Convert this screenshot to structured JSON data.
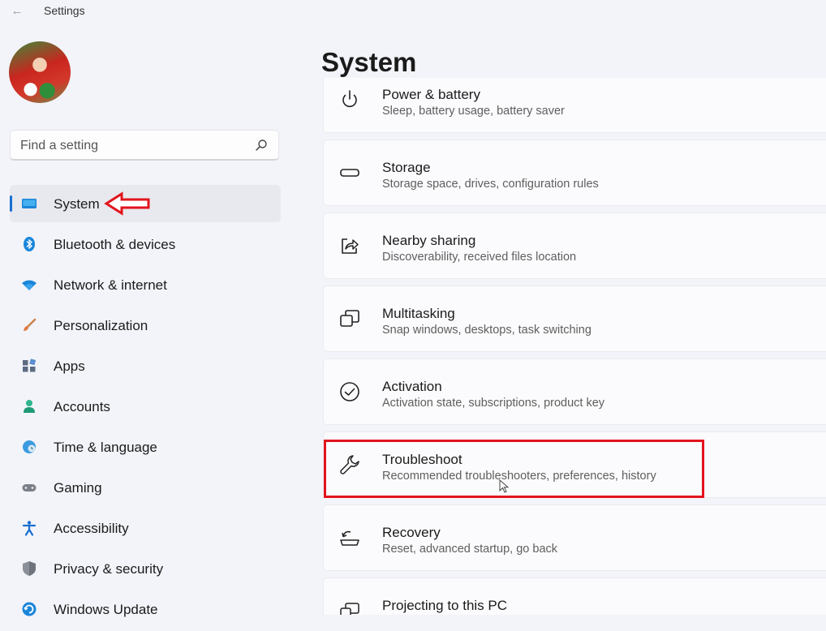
{
  "window": {
    "title": "Settings",
    "back_glyph": "←"
  },
  "user": {
    "avatar": "user-avatar"
  },
  "search": {
    "placeholder": "Find a setting",
    "value": "",
    "icon": "search-icon"
  },
  "sidebar": {
    "items": [
      {
        "label": "System",
        "icon": "monitor-icon",
        "active": true
      },
      {
        "label": "Bluetooth & devices",
        "icon": "bluetooth-icon"
      },
      {
        "label": "Network & internet",
        "icon": "wifi-icon"
      },
      {
        "label": "Personalization",
        "icon": "brush-icon"
      },
      {
        "label": "Apps",
        "icon": "apps-icon"
      },
      {
        "label": "Accounts",
        "icon": "person-icon"
      },
      {
        "label": "Time & language",
        "icon": "globe-clock-icon"
      },
      {
        "label": "Gaming",
        "icon": "gamepad-icon"
      },
      {
        "label": "Accessibility",
        "icon": "accessibility-icon"
      },
      {
        "label": "Privacy & security",
        "icon": "shield-icon"
      },
      {
        "label": "Windows Update",
        "icon": "update-icon"
      }
    ]
  },
  "main": {
    "title": "System",
    "cards": [
      {
        "title": "Power & battery",
        "subtitle": "Sleep, battery usage, battery saver",
        "icon": "power-icon"
      },
      {
        "title": "Storage",
        "subtitle": "Storage space, drives, configuration rules",
        "icon": "storage-icon"
      },
      {
        "title": "Nearby sharing",
        "subtitle": "Discoverability, received files location",
        "icon": "share-icon"
      },
      {
        "title": "Multitasking",
        "subtitle": "Snap windows, desktops, task switching",
        "icon": "multitask-icon"
      },
      {
        "title": "Activation",
        "subtitle": "Activation state, subscriptions, product key",
        "icon": "check-circle-icon"
      },
      {
        "title": "Troubleshoot",
        "subtitle": "Recommended troubleshooters, preferences, history",
        "icon": "wrench-icon"
      },
      {
        "title": "Recovery",
        "subtitle": "Reset, advanced startup, go back",
        "icon": "recovery-icon"
      },
      {
        "title": "Projecting to this PC",
        "subtitle": "",
        "icon": "projector-icon"
      }
    ]
  },
  "colors": {
    "accent": "#1a6ed0",
    "annotation": "#e2141d",
    "background": "#f3f4f9"
  }
}
